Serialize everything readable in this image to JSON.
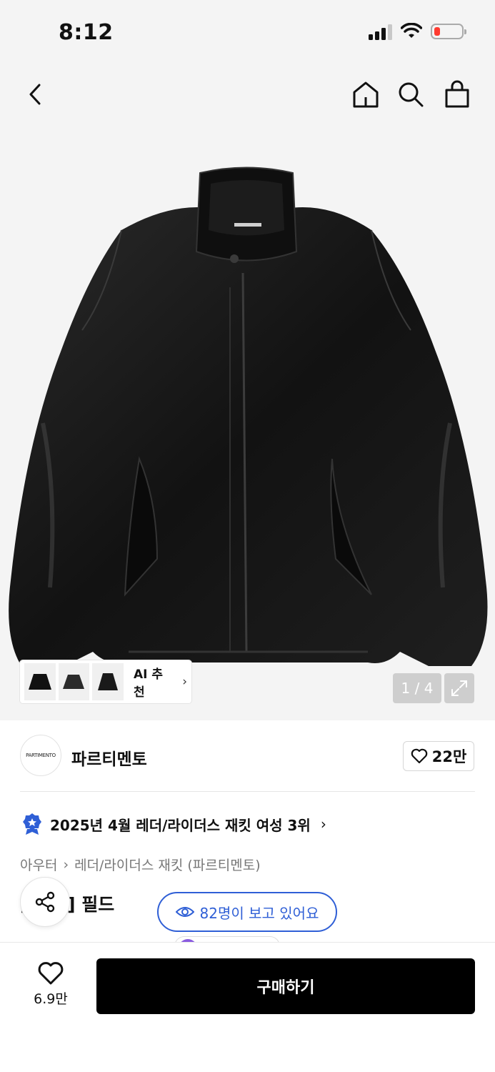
{
  "status_bar": {
    "time": "8:12"
  },
  "hero": {
    "ai_recommend_label": "AI 추천",
    "image_counter": "1 / 4"
  },
  "brand": {
    "logo_text": "PARTIMENTO",
    "name": "파르티멘토",
    "likes": "22만"
  },
  "ranking": {
    "text": "2025년 4월 레더/라이더스 재킷 여성 3위"
  },
  "breadcrumb": {
    "category": "아우터",
    "subcategory": "레더/라이더스 재킷 (파르티멘토)"
  },
  "product": {
    "title_visible": "[ 레더] 필드"
  },
  "viewers": {
    "text": "82명이 보고 있어요"
  },
  "bottom_bar": {
    "wish_count": "6.9만",
    "buy_label": "구매하기"
  },
  "colors": {
    "accent_blue": "#2f5fd6",
    "buy_button": "#000000",
    "battery_low": "#ff3b30"
  }
}
